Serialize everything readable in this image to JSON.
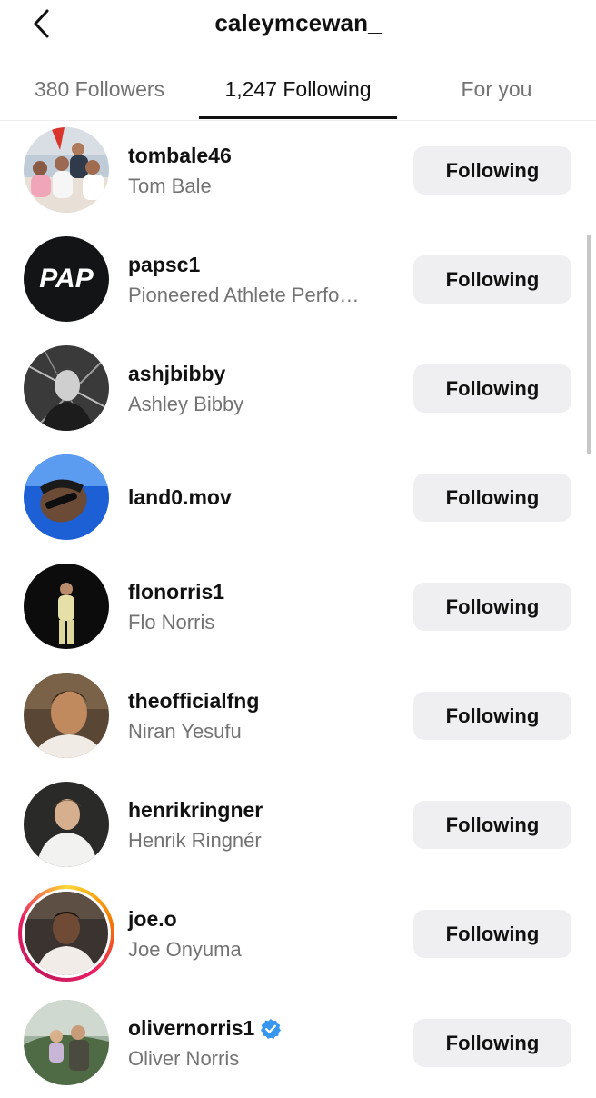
{
  "header": {
    "back_icon": "chevron-left-icon",
    "title": "caleymcewan_"
  },
  "tabs": [
    {
      "label": "380 Followers",
      "active": false
    },
    {
      "label": "1,247 Following",
      "active": true
    },
    {
      "label": "For you",
      "active": false
    }
  ],
  "users": [
    {
      "username": "tombale46",
      "fullname": "Tom Bale",
      "button": "Following",
      "verified": false,
      "story": false
    },
    {
      "username": "papsc1",
      "fullname": "Pioneered Athlete Perfo…",
      "button": "Following",
      "verified": false,
      "story": false,
      "avatar_text": "PAP"
    },
    {
      "username": "ashjbibby",
      "fullname": "Ashley Bibby",
      "button": "Following",
      "verified": false,
      "story": false
    },
    {
      "username": "land0.mov",
      "fullname": "",
      "button": "Following",
      "verified": false,
      "story": false
    },
    {
      "username": "flonorris1",
      "fullname": "Flo Norris",
      "button": "Following",
      "verified": false,
      "story": false
    },
    {
      "username": "theofficialfng",
      "fullname": "Niran Yesufu",
      "button": "Following",
      "verified": false,
      "story": false
    },
    {
      "username": "henrikringner",
      "fullname": "Henrik Ringnér",
      "button": "Following",
      "verified": false,
      "story": false
    },
    {
      "username": "joe.o",
      "fullname": "Joe Onyuma",
      "button": "Following",
      "verified": false,
      "story": true
    },
    {
      "username": "olivernorris1",
      "fullname": "Oliver Norris",
      "button": "Following",
      "verified": true,
      "story": false
    }
  ],
  "colors": {
    "verified_badge": "#3797f0",
    "secondary_text": "#737373",
    "button_bg": "#efeff1"
  }
}
